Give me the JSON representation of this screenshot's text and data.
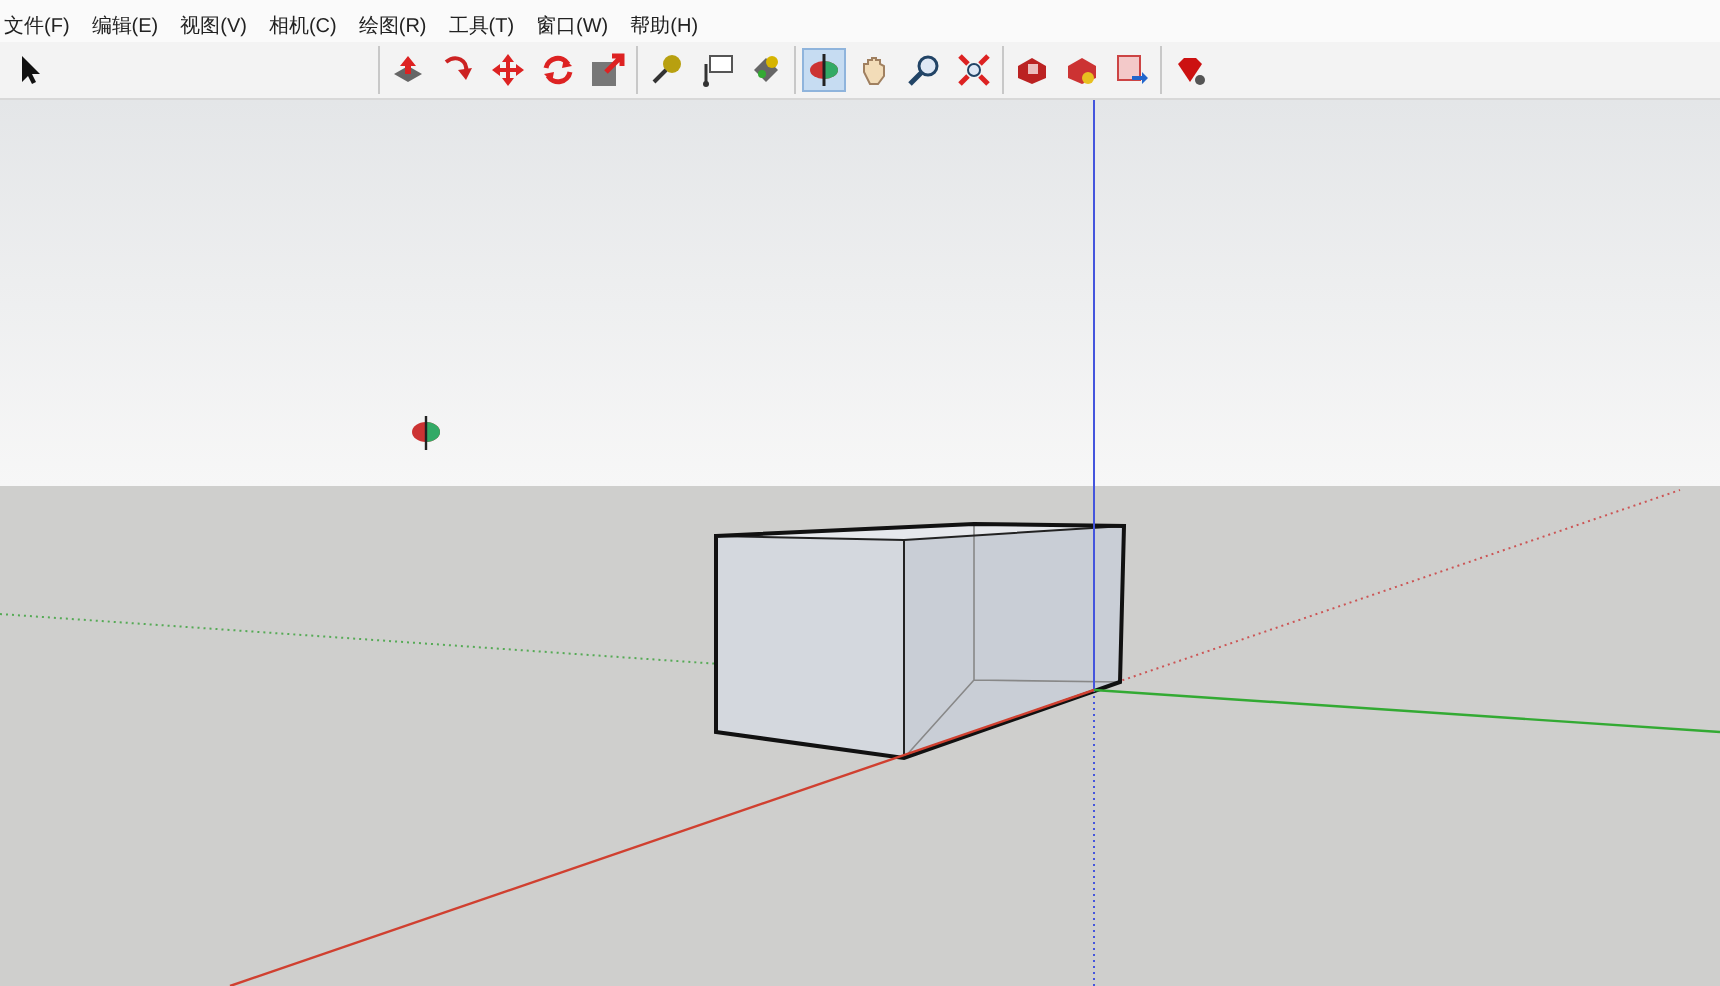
{
  "menu": [
    {
      "label": "文件(F)"
    },
    {
      "label": "编辑(E)"
    },
    {
      "label": "视图(V)"
    },
    {
      "label": "相机(C)"
    },
    {
      "label": "绘图(R)"
    },
    {
      "label": "工具(T)"
    },
    {
      "label": "窗口(W)"
    },
    {
      "label": "帮助(H)"
    }
  ],
  "toolbar": [
    {
      "tools": [
        {
          "kind": "select",
          "selected": false
        }
      ]
    },
    {
      "tools": [
        {
          "kind": "pushpull",
          "selected": false
        },
        {
          "kind": "followme",
          "selected": false
        },
        {
          "kind": "move",
          "selected": false
        },
        {
          "kind": "rotate",
          "selected": false
        },
        {
          "kind": "scale",
          "selected": false
        }
      ]
    },
    {
      "tools": [
        {
          "kind": "tape",
          "selected": false
        },
        {
          "kind": "text",
          "selected": false
        },
        {
          "kind": "paint",
          "selected": false
        }
      ]
    },
    {
      "tools": [
        {
          "kind": "orbit",
          "selected": true
        },
        {
          "kind": "pan",
          "selected": false
        },
        {
          "kind": "zoom",
          "selected": false
        },
        {
          "kind": "extents",
          "selected": false
        }
      ]
    },
    {
      "tools": [
        {
          "kind": "component",
          "selected": false
        },
        {
          "kind": "warehouse",
          "selected": false
        },
        {
          "kind": "export",
          "selected": false
        }
      ]
    },
    {
      "tools": [
        {
          "kind": "ruby",
          "selected": false
        }
      ]
    }
  ]
}
